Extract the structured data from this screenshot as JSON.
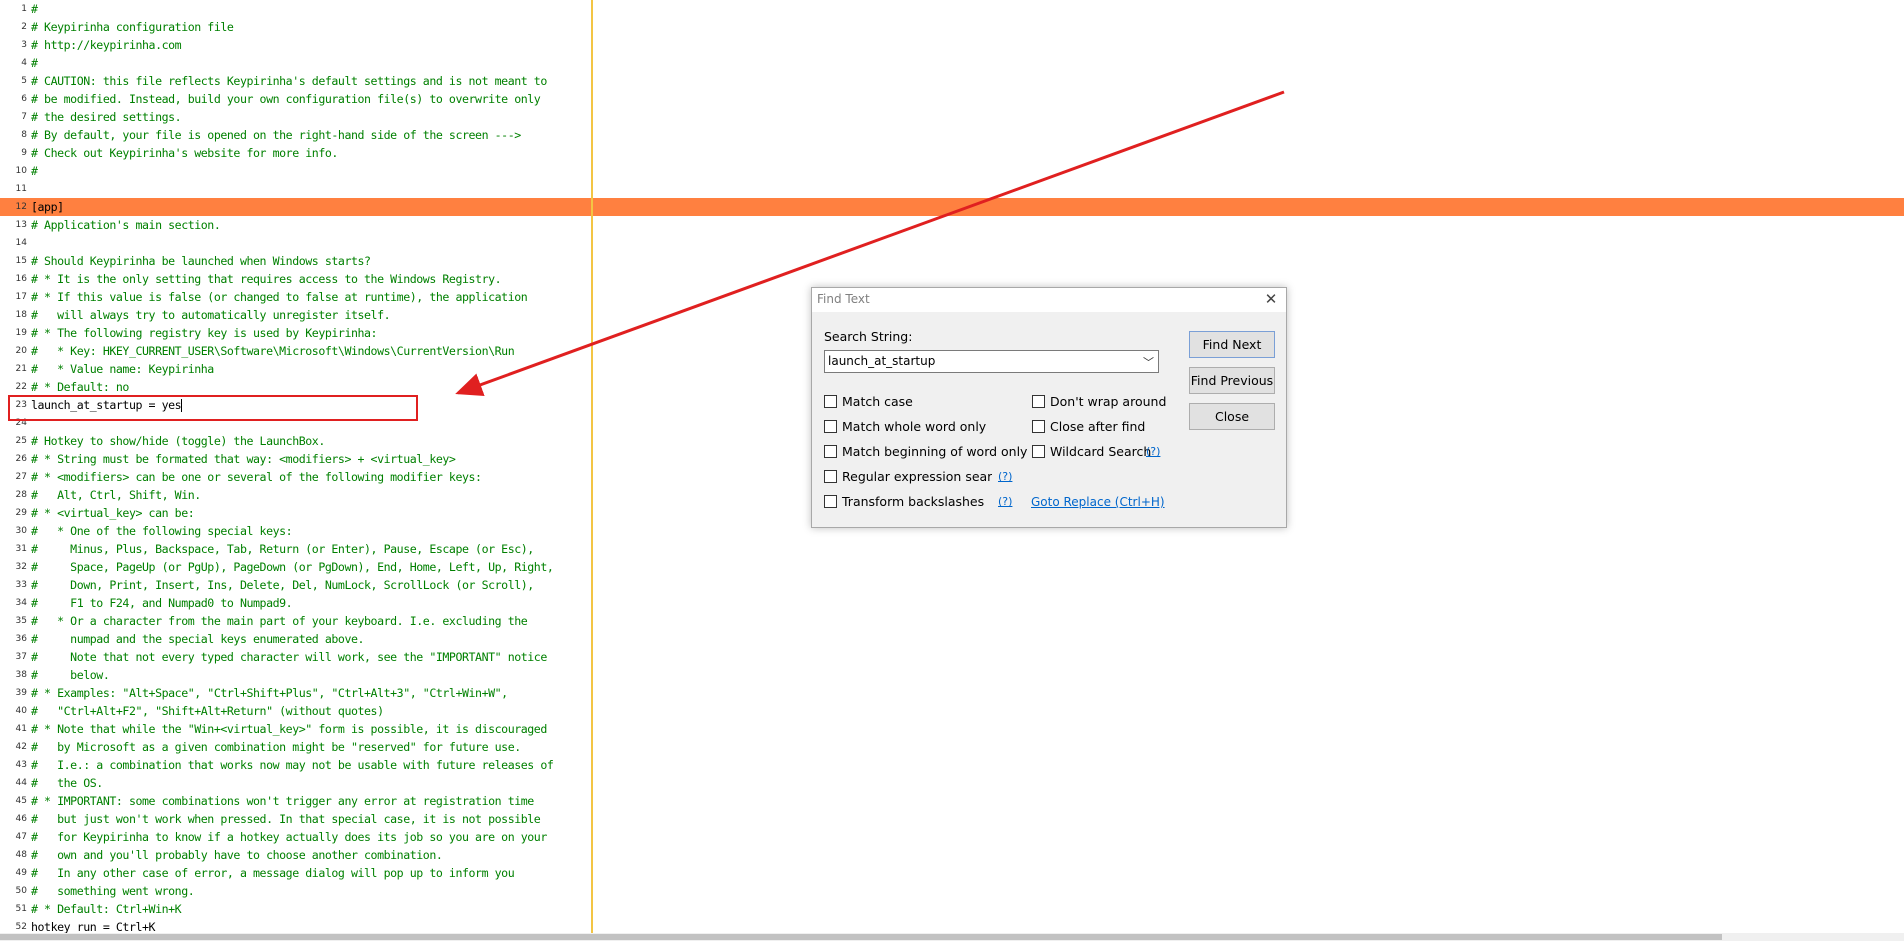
{
  "editor": {
    "lines": [
      {
        "n": "1",
        "t": "#",
        "k": "comment"
      },
      {
        "n": "2",
        "t": "# Keypirinha configuration file",
        "k": "comment"
      },
      {
        "n": "3",
        "t": "# http://keypirinha.com",
        "k": "comment"
      },
      {
        "n": "4",
        "t": "#",
        "k": "comment"
      },
      {
        "n": "5",
        "t": "# CAUTION: this file reflects Keypirinha's default settings and is not meant to",
        "k": "comment"
      },
      {
        "n": "6",
        "t": "# be modified. Instead, build your own configuration file(s) to overwrite only",
        "k": "comment"
      },
      {
        "n": "7",
        "t": "# the desired settings.",
        "k": "comment"
      },
      {
        "n": "8",
        "t": "# By default, your file is opened on the right-hand side of the screen --->",
        "k": "comment"
      },
      {
        "n": "9",
        "t": "# Check out Keypirinha's website for more info.",
        "k": "comment"
      },
      {
        "n": "10",
        "t": "#",
        "k": "comment"
      },
      {
        "n": "11",
        "t": "",
        "k": "code"
      },
      {
        "n": "12",
        "t": "[app]",
        "k": "section"
      },
      {
        "n": "13",
        "t": "# Application's main section.",
        "k": "comment"
      },
      {
        "n": "14",
        "t": "",
        "k": "code"
      },
      {
        "n": "15",
        "t": "# Should Keypirinha be launched when Windows starts?",
        "k": "comment"
      },
      {
        "n": "16",
        "t": "# * It is the only setting that requires access to the Windows Registry.",
        "k": "comment"
      },
      {
        "n": "17",
        "t": "# * If this value is false (or changed to false at runtime), the application",
        "k": "comment"
      },
      {
        "n": "18",
        "t": "#   will always try to automatically unregister itself.",
        "k": "comment"
      },
      {
        "n": "19",
        "t": "# * The following registry key is used by Keypirinha:",
        "k": "comment"
      },
      {
        "n": "20",
        "t": "#   * Key: HKEY_CURRENT_USER\\Software\\Microsoft\\Windows\\CurrentVersion\\Run",
        "k": "comment"
      },
      {
        "n": "21",
        "t": "#   * Value name: Keypirinha",
        "k": "comment"
      },
      {
        "n": "22",
        "t": "# * Default: no",
        "k": "comment"
      },
      {
        "n": "23",
        "t": "launch_at_startup = yes",
        "k": "code"
      },
      {
        "n": "24",
        "t": "",
        "k": "code"
      },
      {
        "n": "25",
        "t": "# Hotkey to show/hide (toggle) the LaunchBox.",
        "k": "comment"
      },
      {
        "n": "26",
        "t": "# * String must be formated that way: <modifiers> + <virtual_key>",
        "k": "comment"
      },
      {
        "n": "27",
        "t": "# * <modifiers> can be one or several of the following modifier keys:",
        "k": "comment"
      },
      {
        "n": "28",
        "t": "#   Alt, Ctrl, Shift, Win.",
        "k": "comment"
      },
      {
        "n": "29",
        "t": "# * <virtual_key> can be:",
        "k": "comment"
      },
      {
        "n": "30",
        "t": "#   * One of the following special keys:",
        "k": "comment"
      },
      {
        "n": "31",
        "t": "#     Minus, Plus, Backspace, Tab, Return (or Enter), Pause, Escape (or Esc),",
        "k": "comment"
      },
      {
        "n": "32",
        "t": "#     Space, PageUp (or PgUp), PageDown (or PgDown), End, Home, Left, Up, Right,",
        "k": "comment"
      },
      {
        "n": "33",
        "t": "#     Down, Print, Insert, Ins, Delete, Del, NumLock, ScrollLock (or Scroll),",
        "k": "comment"
      },
      {
        "n": "34",
        "t": "#     F1 to F24, and Numpad0 to Numpad9.",
        "k": "comment"
      },
      {
        "n": "35",
        "t": "#   * Or a character from the main part of your keyboard. I.e. excluding the",
        "k": "comment"
      },
      {
        "n": "36",
        "t": "#     numpad and the special keys enumerated above.",
        "k": "comment"
      },
      {
        "n": "37",
        "t": "#     Note that not every typed character will work, see the \"IMPORTANT\" notice",
        "k": "comment"
      },
      {
        "n": "38",
        "t": "#     below.",
        "k": "comment"
      },
      {
        "n": "39",
        "t": "# * Examples: \"Alt+Space\", \"Ctrl+Shift+Plus\", \"Ctrl+Alt+3\", \"Ctrl+Win+W\",",
        "k": "comment"
      },
      {
        "n": "40",
        "t": "#   \"Ctrl+Alt+F2\", \"Shift+Alt+Return\" (without quotes)",
        "k": "comment"
      },
      {
        "n": "41",
        "t": "# * Note that while the \"Win+<virtual_key>\" form is possible, it is discouraged",
        "k": "comment"
      },
      {
        "n": "42",
        "t": "#   by Microsoft as a given combination might be \"reserved\" for future use.",
        "k": "comment"
      },
      {
        "n": "43",
        "t": "#   I.e.: a combination that works now may not be usable with future releases of",
        "k": "comment"
      },
      {
        "n": "44",
        "t": "#   the OS.",
        "k": "comment"
      },
      {
        "n": "45",
        "t": "# * IMPORTANT: some combinations won't trigger any error at registration time",
        "k": "comment"
      },
      {
        "n": "46",
        "t": "#   but just won't work when pressed. In that special case, it is not possible",
        "k": "comment"
      },
      {
        "n": "47",
        "t": "#   for Keypirinha to know if a hotkey actually does its job so you are on your",
        "k": "comment"
      },
      {
        "n": "48",
        "t": "#   own and you'll probably have to choose another combination.",
        "k": "comment"
      },
      {
        "n": "49",
        "t": "#   In any other case of error, a message dialog will pop up to inform you",
        "k": "comment"
      },
      {
        "n": "50",
        "t": "#   something went wrong.",
        "k": "comment"
      },
      {
        "n": "51",
        "t": "# * Default: Ctrl+Win+K",
        "k": "comment"
      },
      {
        "n": "52",
        "t": "hotkey_run = Ctrl+K",
        "k": "code"
      }
    ],
    "highlight_line": "12",
    "caret_line": "23",
    "colors": {
      "comment": "#008000",
      "highlight": "#ff8040",
      "edge_line": "#f3c544",
      "callout": "#e02020"
    }
  },
  "find_dialog": {
    "title": "Find Text",
    "search_label": "Search String:",
    "search_value": "launch_at_startup",
    "buttons": {
      "find_next": "Find Next",
      "find_previous": "Find Previous",
      "close": "Close"
    },
    "options_left": [
      {
        "label": "Match case",
        "checked": false
      },
      {
        "label": "Match whole word only",
        "checked": false
      },
      {
        "label": "Match beginning of word only",
        "checked": false
      },
      {
        "label": "Regular expression search",
        "checked": false
      },
      {
        "label": "Transform backslashes",
        "checked": false
      }
    ],
    "options_right": [
      {
        "label": "Don't wrap around",
        "checked": false
      },
      {
        "label": "Close after find",
        "checked": false
      },
      {
        "label": "Wildcard Search",
        "checked": false
      }
    ],
    "help_marker": "(?)",
    "goto_replace": "Goto Replace (Ctrl+H)"
  }
}
